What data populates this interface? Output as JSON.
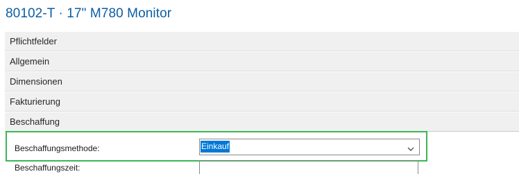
{
  "page": {
    "title": "80102-T · 17\" M780 Monitor"
  },
  "sections": [
    {
      "label": "Pflichtfelder"
    },
    {
      "label": "Allgemein"
    },
    {
      "label": "Dimensionen"
    },
    {
      "label": "Fakturierung"
    },
    {
      "label": "Beschaffung"
    }
  ],
  "fields": {
    "beschaffungsmethode": {
      "label": "Beschaffungsmethode:",
      "value": "Einkauf"
    },
    "beschaffungszeit": {
      "label": "Beschaffungszeit:",
      "value": ""
    }
  },
  "colors": {
    "title": "#0a5ea3",
    "highlight_border": "#3cb556",
    "selection": "#0078d7"
  }
}
